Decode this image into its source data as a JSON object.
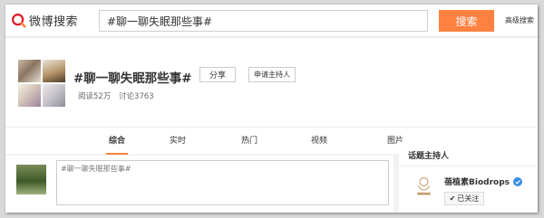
{
  "brand": {
    "logo_text": "微博搜索",
    "accent": "#ff8140"
  },
  "search": {
    "value": "#聊一聊失眠那些事#",
    "button_label": "搜索",
    "advanced_label": "高级搜索"
  },
  "topic": {
    "title": "#聊一聊失眠那些事#",
    "share_label": "分享",
    "apply_host_label": "申请主持人",
    "stats": {
      "reads": "阅读52万",
      "discussions": "讨论3763"
    }
  },
  "tabs": [
    {
      "label": "综合",
      "active": true
    },
    {
      "label": "实时"
    },
    {
      "label": "热门"
    },
    {
      "label": "视频"
    },
    {
      "label": "图片"
    }
  ],
  "composer": {
    "value": "#聊一聊失眠那些事#"
  },
  "sidebar": {
    "title": "话题主持人",
    "host": {
      "name": "蓓植素Biodrops",
      "verified": true,
      "follow_label": "已关注",
      "follow_icon": "check-icon"
    }
  }
}
